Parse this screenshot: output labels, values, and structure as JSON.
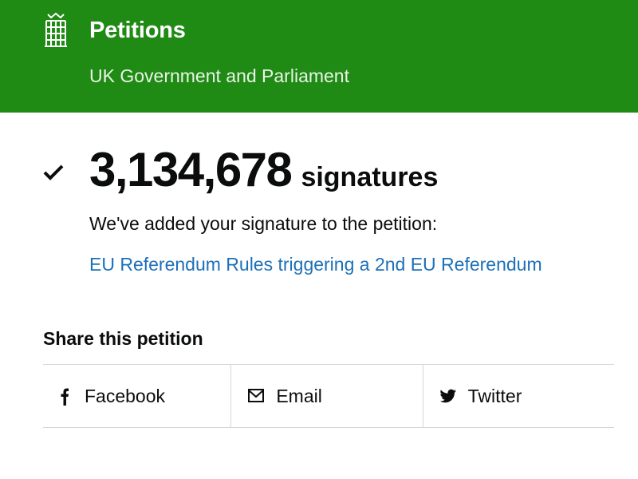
{
  "header": {
    "title": "Petitions",
    "subtitle": "UK Government and Parliament",
    "logo_icon": "portcullis-icon",
    "background_color": "#1f8a14"
  },
  "signature": {
    "status_icon": "checkmark-icon",
    "count": "3,134,678",
    "unit": "signatures",
    "confirmation": "We've added your signature to the petition:",
    "petition_title": "EU Referendum Rules triggering a 2nd EU Referendum",
    "link_color": "#1d70b8"
  },
  "share": {
    "heading": "Share this petition",
    "options": [
      {
        "label": "Facebook",
        "icon": "facebook-icon"
      },
      {
        "label": "Email",
        "icon": "email-icon"
      },
      {
        "label": "Twitter",
        "icon": "twitter-icon"
      }
    ]
  }
}
